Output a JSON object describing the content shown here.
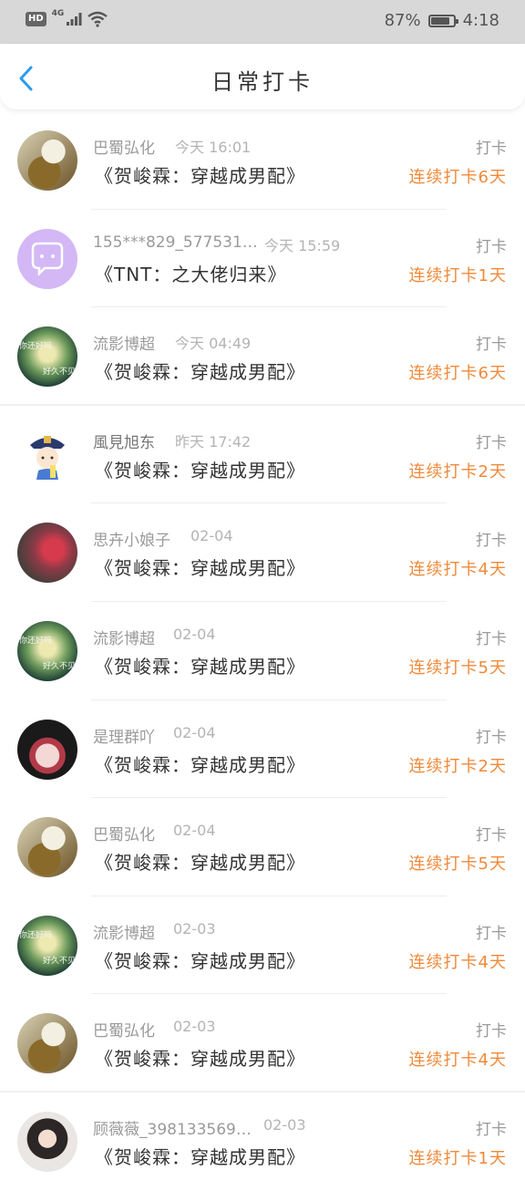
{
  "status_bar": {
    "hd": "HD",
    "network": "4G",
    "battery_percent": "87%",
    "battery_level": 0.87,
    "time": "4:18"
  },
  "header": {
    "title": "日常打卡",
    "back_icon": "chevron-left-icon"
  },
  "accent_color": "#2a9cf0",
  "streak_color": "#ef8a3b",
  "list": [
    {
      "name": "巴蜀弘化",
      "time": "今天 16:01",
      "book": "《贺峻霖：穿越成男配》",
      "tag": "打卡",
      "streak": "连续打卡6天",
      "avatar": "anime-avatar"
    },
    {
      "name": "155***829_577531…",
      "time": "今天 15:59",
      "book": "《TNT：之大佬归来》",
      "tag": "打卡",
      "streak": "连续打卡1天",
      "avatar": "chat-bubble-avatar"
    },
    {
      "name": "流影博超",
      "time": "今天 04:49",
      "book": "《贺峻霖：穿越成男配》",
      "tag": "打卡",
      "streak": "连续打卡6天",
      "avatar": "green-avatar"
    },
    {
      "name": "風見旭东",
      "time": "昨天 17:42",
      "book": "《贺峻霖：穿越成男配》",
      "tag": "打卡",
      "streak": "连续打卡2天",
      "avatar": "cartoon-avatar"
    },
    {
      "name": "思卉小娘子",
      "time": "02-04",
      "book": "《贺峻霖：穿越成男配》",
      "tag": "打卡",
      "streak": "连续打卡4天",
      "avatar": "flower-avatar"
    },
    {
      "name": "流影博超",
      "time": "02-04",
      "book": "《贺峻霖：穿越成男配》",
      "tag": "打卡",
      "streak": "连续打卡5天",
      "avatar": "green-avatar"
    },
    {
      "name": "是理群吖",
      "time": "02-04",
      "book": "《贺峻霖：穿越成男配》",
      "tag": "打卡",
      "streak": "连续打卡2天",
      "avatar": "anime-girl-avatar"
    },
    {
      "name": "巴蜀弘化",
      "time": "02-04",
      "book": "《贺峻霖：穿越成男配》",
      "tag": "打卡",
      "streak": "连续打卡5天",
      "avatar": "anime-avatar"
    },
    {
      "name": "流影博超",
      "time": "02-03",
      "book": "《贺峻霖：穿越成男配》",
      "tag": "打卡",
      "streak": "连续打卡4天",
      "avatar": "green-avatar"
    },
    {
      "name": "巴蜀弘化",
      "time": "02-03",
      "book": "《贺峻霖：穿越成男配》",
      "tag": "打卡",
      "streak": "连续打卡4天",
      "avatar": "anime-avatar"
    },
    {
      "name": "顾薇薇_398133569…",
      "time": "02-03",
      "book": "《贺峻霖：穿越成男配》",
      "tag": "打卡",
      "streak": "连续打卡1天",
      "avatar": "photo-avatar"
    }
  ],
  "avatar_texts": {
    "top": "你还好吗",
    "bottom": "好久不见"
  }
}
